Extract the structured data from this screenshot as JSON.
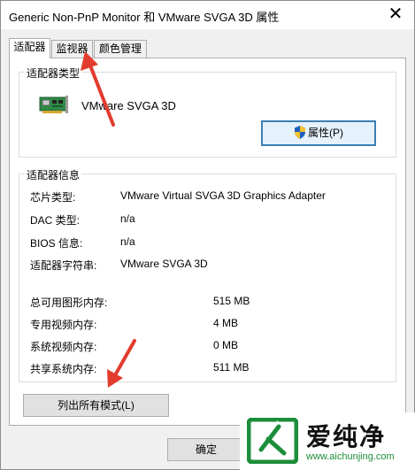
{
  "window": {
    "title": "Generic Non-PnP Monitor 和 VMware SVGA 3D 属性",
    "close_glyph": "✕"
  },
  "tabs": [
    {
      "label": "适配器",
      "active": true
    },
    {
      "label": "监视器",
      "active": false
    },
    {
      "label": "颜色管理",
      "active": false
    }
  ],
  "adapter_type": {
    "group_label": "适配器类型",
    "name": "VMware SVGA 3D",
    "properties_button": "属性(P)"
  },
  "adapter_info": {
    "group_label": "适配器信息",
    "rows": [
      {
        "label": "芯片类型:",
        "value": "VMware Virtual SVGA 3D Graphics Adapter"
      },
      {
        "label": "DAC 类型:",
        "value": "n/a"
      },
      {
        "label": "BIOS 信息:",
        "value": "n/a"
      },
      {
        "label": "适配器字符串:",
        "value": "VMware SVGA 3D"
      }
    ],
    "memory": [
      {
        "label": "总可用图形内存:",
        "value": "515 MB"
      },
      {
        "label": "专用视频内存:",
        "value": "4 MB"
      },
      {
        "label": "系统视频内存:",
        "value": "0 MB"
      },
      {
        "label": "共享系统内存:",
        "value": "511 MB"
      }
    ]
  },
  "list_modes_button": "列出所有模式(L)",
  "ok_button": "确定",
  "watermark": {
    "name": "爱纯净",
    "url": "www.aichunjing.com"
  },
  "colors": {
    "accent_arrow": "#e23c2e",
    "focus_border": "#3c7fb1",
    "watermark_green": "#1c8d3a"
  },
  "icons": [
    "graphics-card-icon",
    "uac-shield-icon",
    "close-icon",
    "watermark-logo-icon"
  ]
}
